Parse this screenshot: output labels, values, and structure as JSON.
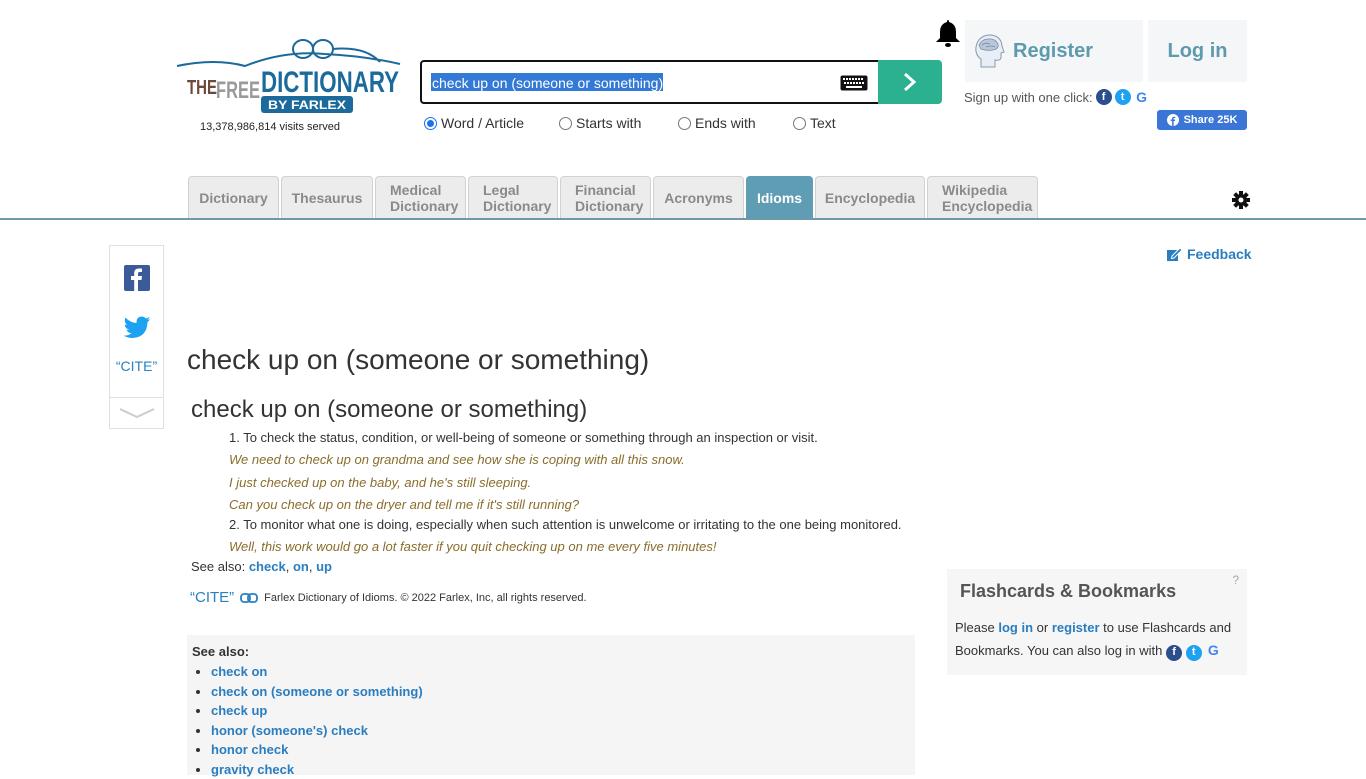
{
  "header": {
    "logo_text": {
      "the": "THE",
      "free": "FREE",
      "dictionary": "DICTIONARY",
      "by": "BY FARLEX"
    },
    "visits": "13,378,986,814 visits served",
    "search": {
      "value": "check up on (someone or something)",
      "placeholder": "",
      "options": [
        {
          "label": "Word / Article",
          "checked": true
        },
        {
          "label": "Starts with",
          "checked": false
        },
        {
          "label": "Ends with",
          "checked": false
        },
        {
          "label": "Text",
          "checked": false
        }
      ]
    },
    "register_label": "Register",
    "login_label": "Log in",
    "signup_text": "Sign up with one click:",
    "share_label": "Share 25K"
  },
  "tabs": [
    {
      "label": "Dictionary",
      "active": false
    },
    {
      "label": "Thesaurus",
      "active": false
    },
    {
      "label": "Medical Dictionary",
      "active": false
    },
    {
      "label": "Legal Dictionary",
      "active": false
    },
    {
      "label": "Financial Dictionary",
      "active": false
    },
    {
      "label": "Acronyms",
      "active": false
    },
    {
      "label": "Idioms",
      "active": true
    },
    {
      "label": "Encyclopedia",
      "active": false
    },
    {
      "label": "Wikipedia Encyclopedia",
      "active": false
    }
  ],
  "sidebar": {
    "cite_label": "“CITE”"
  },
  "feedback_label": "Feedback",
  "main": {
    "page_title": "check up on (someone or something)",
    "entry_title": "check up on (someone or something)",
    "definitions": [
      {
        "text": "1. To check the status, condition, or well-being of someone or something through an inspection or visit.",
        "examples": [
          "We need to check up on grandma and see how she is coping with all this snow.",
          "I just checked up on the baby, and he's still sleeping.",
          "Can you check up on the dryer and tell me if it's still running?"
        ]
      },
      {
        "text": "2. To monitor what one is doing, especially when such attention is unwelcome or irritating to the one being monitored.",
        "examples": [
          "Well, this work would go a lot faster if you quit checking up on me every five minutes!"
        ]
      }
    ],
    "see_also_prefix": "See also:",
    "see_also_links": [
      "check",
      "on",
      "up"
    ],
    "cite_label": "“CITE”",
    "credit": "Farlex Dictionary of Idioms. © 2022 Farlex, Inc, all rights reserved."
  },
  "see_also_box": {
    "heading": "See also:",
    "items": [
      "check on",
      "check on (someone or something)",
      "check up",
      "honor (someone's) check",
      "honor check",
      "gravity check"
    ]
  },
  "flashcards": {
    "title": "Flashcards & Bookmarks",
    "help": "?",
    "text_before": "Please ",
    "login_link": "log in",
    "text_mid": " or ",
    "register_link": "register",
    "text_after": " to use Flashcards and Bookmarks. You can also log in with"
  },
  "colors": {
    "accent": "#5e9db3",
    "search_button": "#2bb090",
    "link": "#2a7dbf",
    "example": "#8a6d2c"
  }
}
